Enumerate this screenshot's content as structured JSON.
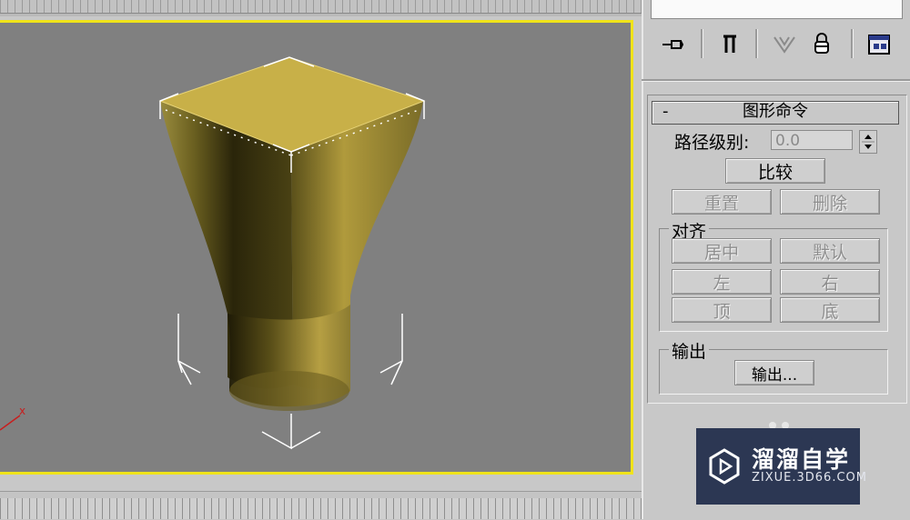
{
  "toolbar": {
    "icons": [
      "pin-stack-icon",
      "modifier-show-end-icon",
      "make-unique-icon",
      "remove-modifier-icon",
      "configure-sets-icon"
    ]
  },
  "rollout": {
    "collapse": "-",
    "title": "图形命令",
    "path_level_label": "路径级别:",
    "path_level_value": "0.0",
    "compare_button": "比较",
    "reset_button": "重置",
    "delete_button": "删除"
  },
  "align_group": {
    "label": "对齐",
    "center": "居中",
    "default": "默认",
    "left": "左",
    "right": "右",
    "top": "顶",
    "bottom": "底"
  },
  "output_group": {
    "label": "输出",
    "output_button": "输出..."
  },
  "viewport": {
    "axis_label": "x",
    "border_color": "#f0e31a",
    "object_color": "#c8b048"
  },
  "watermark": {
    "title": "溜溜自学",
    "subtitle": "ZIXUE.3D66.COM"
  }
}
